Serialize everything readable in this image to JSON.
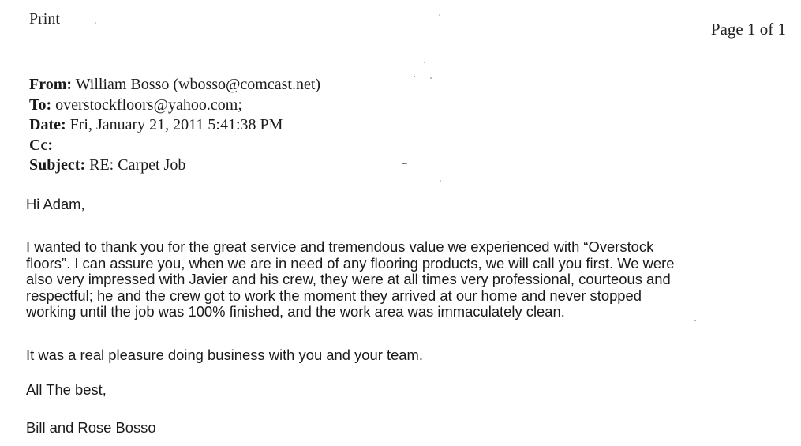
{
  "print_label": "Print",
  "page_number": "Page 1 of 1",
  "header": {
    "from_label": "From:",
    "from_value": "William Bosso (wbosso@comcast.net)",
    "to_label": "To:",
    "to_value": "overstockfloors@yahoo.com;",
    "date_label": "Date:",
    "date_value": "Fri, January 21, 2011 5:41:38 PM",
    "cc_label": "Cc:",
    "cc_value": "",
    "subject_label": "Subject:",
    "subject_value": "RE: Carpet Job"
  },
  "body": {
    "greeting": "Hi Adam,",
    "paragraph_lines": [
      "I wanted to thank you for the great service and tremendous value we experienced with “Overstock",
      "floors”.  I can assure you, when we are in need of any flooring products, we will call you first.  We were",
      "also very impressed with Javier and his crew, they were at all times very professional, courteous and",
      "respectful; he and the crew got to work the moment they arrived at our home and never stopped",
      "working until the job was 100% finished, and the work area was immaculately clean."
    ],
    "closing_line": "It was a real pleasure doing business with you and your team.",
    "signoff": "All The best,",
    "signature": "Bill and Rose Bosso"
  }
}
